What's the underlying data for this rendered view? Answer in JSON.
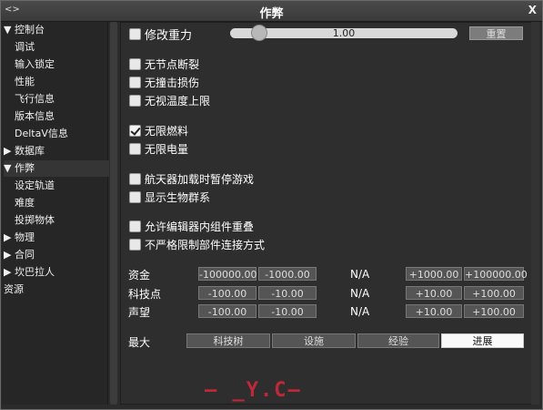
{
  "window": {
    "title": "作弊",
    "left_icon": "<>",
    "close_label": "X"
  },
  "sidebar": {
    "items": [
      {
        "label": "▼ 控制台"
      },
      {
        "label": "调试"
      },
      {
        "label": "输入锁定"
      },
      {
        "label": "性能"
      },
      {
        "label": "飞行信息"
      },
      {
        "label": "版本信息"
      },
      {
        "label": "DeltaV信息"
      },
      {
        "label": "▶ 数据库"
      },
      {
        "label": "▼ 作弊"
      },
      {
        "label": "设定轨道"
      },
      {
        "label": "难度"
      },
      {
        "label": "投掷物体"
      },
      {
        "label": "▶ 物理"
      },
      {
        "label": "▶ 合同"
      },
      {
        "label": "▶ 坎巴拉人"
      },
      {
        "label": "资源"
      }
    ]
  },
  "gravity": {
    "label": "修改重力",
    "value": "1.00",
    "reset_label": "重置",
    "checked": false,
    "slider_fraction": 0.12
  },
  "checkboxes": {
    "no_joint_break": {
      "label": "无节点断裂",
      "checked": false
    },
    "no_crash_damage": {
      "label": "无撞击损伤",
      "checked": false
    },
    "ignore_max_temp": {
      "label": "无视温度上限",
      "checked": false
    },
    "infinite_fuel": {
      "label": "无限燃料",
      "checked": true
    },
    "infinite_electricity": {
      "label": "无限电量",
      "checked": false
    },
    "pause_on_vessel_load": {
      "label": "航天器加载时暂停游戏",
      "checked": false
    },
    "show_biomes": {
      "label": "显示生物群系",
      "checked": false
    },
    "allow_part_clipping": {
      "label": "允许编辑器内组件重叠",
      "checked": false
    },
    "non_strict_attachment": {
      "label": "不严格限制部件连接方式",
      "checked": false
    }
  },
  "resources": {
    "rows": [
      {
        "label": "资金",
        "b1": "-100000.00",
        "b2": "-1000.00",
        "value": "N/A",
        "b3": "+1000.00",
        "b4": "+100000.00"
      },
      {
        "label": "科技点",
        "b1": "-100.00",
        "b2": "-10.00",
        "value": "N/A",
        "b3": "+10.00",
        "b4": "+100.00"
      },
      {
        "label": "声望",
        "b1": "-100.00",
        "b2": "-10.00",
        "value": "N/A",
        "b3": "+10.00",
        "b4": "+100.00"
      }
    ]
  },
  "maximize": {
    "label": "最大",
    "buttons": [
      {
        "label": "科技树"
      },
      {
        "label": "设施"
      },
      {
        "label": "经验"
      },
      {
        "label": "进展"
      }
    ]
  },
  "logo_text": "— _Y.C—",
  "colors": {
    "background": "#2b2b2b",
    "text": "#ffffff",
    "button": "#555555",
    "logo": "#c0283a"
  }
}
